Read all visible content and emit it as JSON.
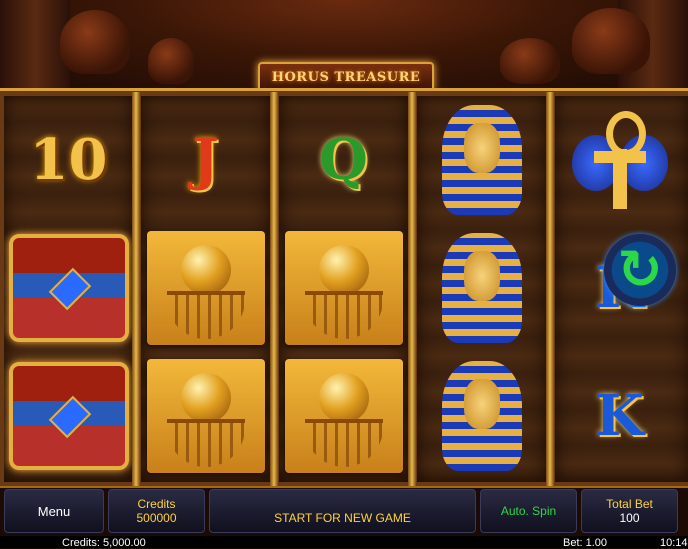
{
  "game": {
    "title": "HORUS TREASURE"
  },
  "reels": [
    [
      "10",
      "chest",
      "chest"
    ],
    [
      "J",
      "orb",
      "orb"
    ],
    [
      "Q",
      "orb",
      "orb"
    ],
    [
      "pharaoh",
      "pharaoh",
      "pharaoh"
    ],
    [
      "ankh",
      "K",
      "K"
    ]
  ],
  "overlay": {
    "icon": "refresh-arrows-icon",
    "color": "#2ad84a"
  },
  "controls": {
    "menu_label": "Menu",
    "credits_label": "Credits",
    "credits_value": "500000",
    "start_label": "START FOR NEW GAME",
    "autospin_label": "Auto. Spin",
    "total_bet_label": "Total Bet",
    "total_bet_value": "100"
  },
  "status": {
    "credits": "Credits: 5,000.00",
    "bet": "Bet: 1.00",
    "time": "10:14"
  },
  "colors": {
    "accent": "#ffd23a",
    "frame_gold": "#d9a23a",
    "autospin_text": "#2ad84a"
  }
}
